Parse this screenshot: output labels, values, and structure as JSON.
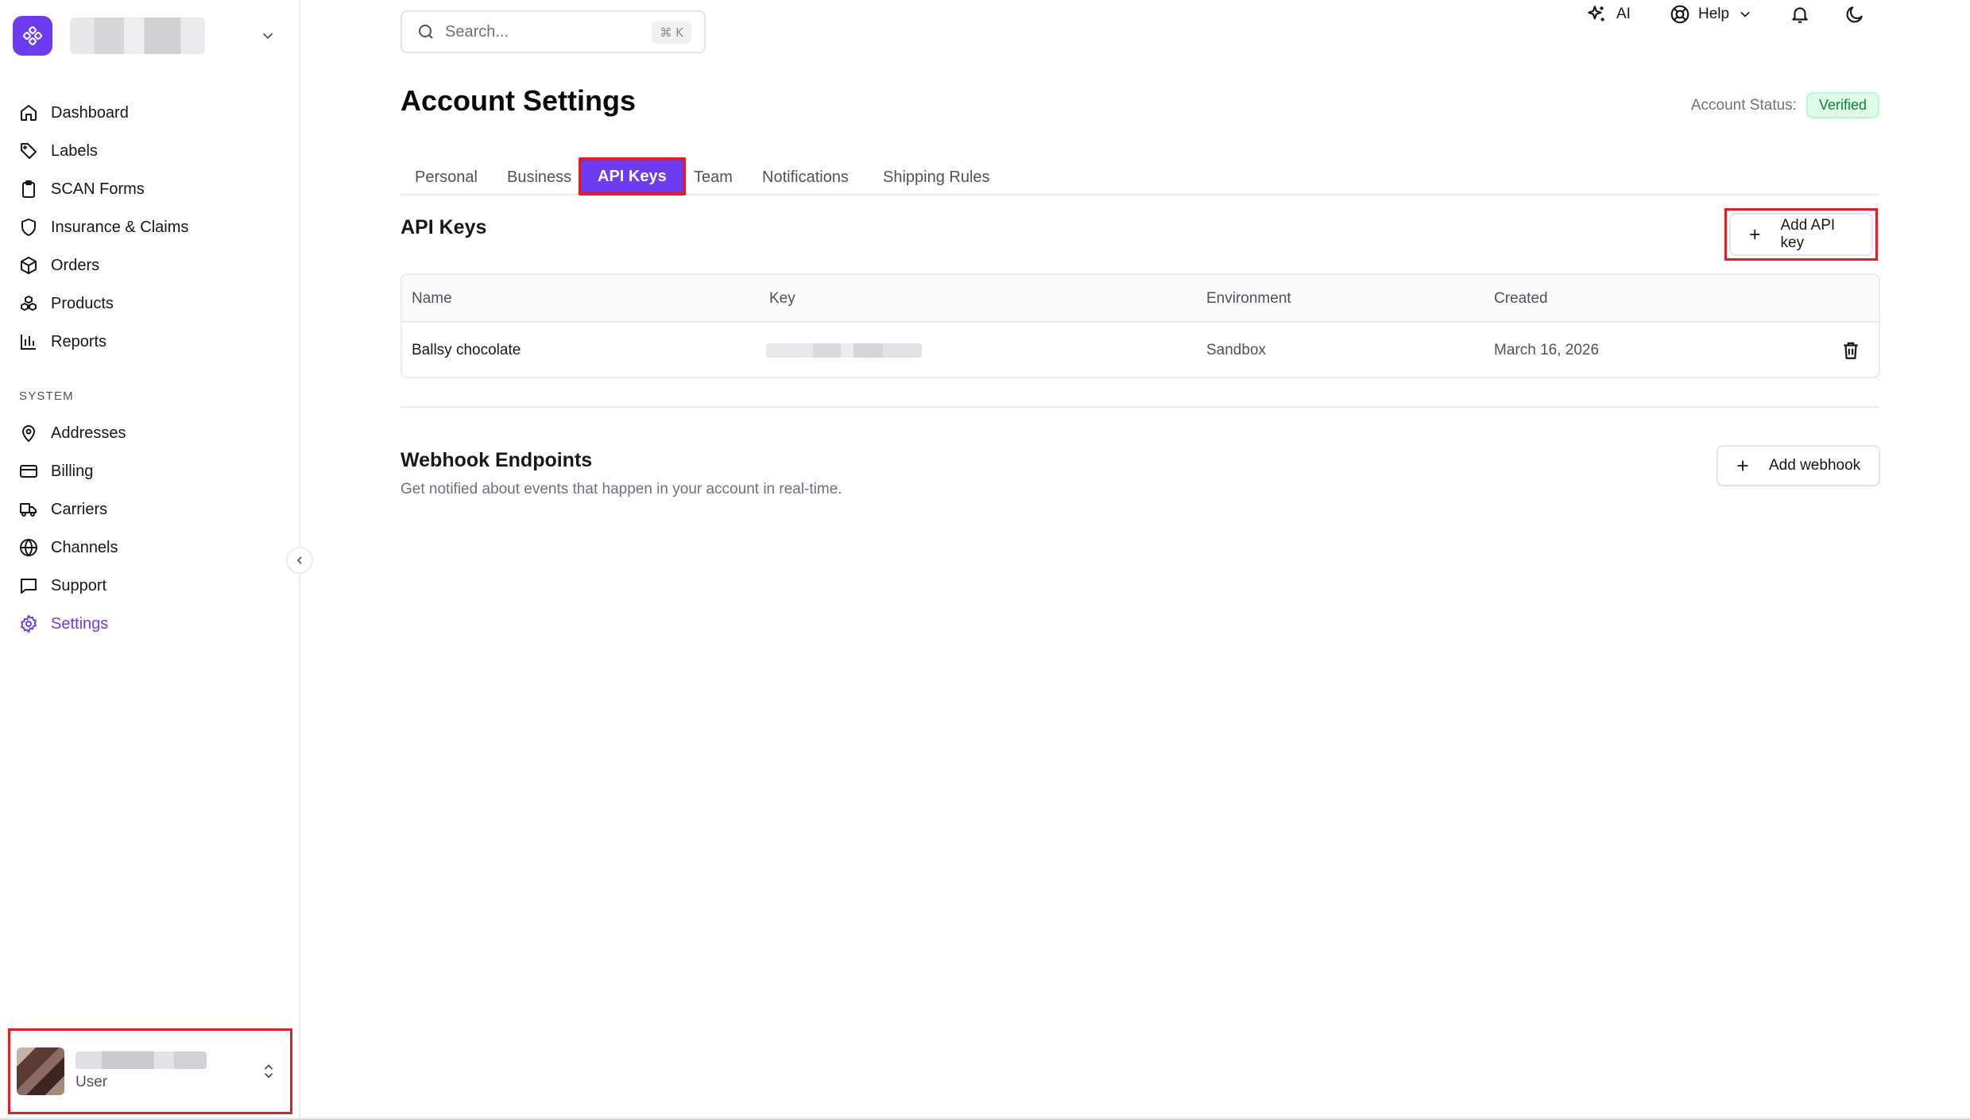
{
  "sidebar": {
    "nav": [
      {
        "label": "Dashboard",
        "icon": "home-icon"
      },
      {
        "label": "Labels",
        "icon": "tag-icon"
      },
      {
        "label": "SCAN Forms",
        "icon": "clipboard-icon"
      },
      {
        "label": "Insurance & Claims",
        "icon": "shield-icon"
      },
      {
        "label": "Orders",
        "icon": "package-icon"
      },
      {
        "label": "Products",
        "icon": "boxes-icon"
      },
      {
        "label": "Reports",
        "icon": "bar-chart-icon"
      }
    ],
    "system_label": "SYSTEM",
    "system": [
      {
        "label": "Addresses",
        "icon": "map-pin-icon"
      },
      {
        "label": "Billing",
        "icon": "credit-card-icon"
      },
      {
        "label": "Carriers",
        "icon": "truck-icon"
      },
      {
        "label": "Channels",
        "icon": "globe-icon"
      },
      {
        "label": "Support",
        "icon": "message-square-icon"
      },
      {
        "label": "Settings",
        "icon": "gear-icon",
        "active": true
      }
    ],
    "user": {
      "role": "User"
    }
  },
  "topbar": {
    "search_placeholder": "Search...",
    "search_shortcut": "⌘ K",
    "ai_label": "AI",
    "help_label": "Help"
  },
  "page": {
    "title": "Account Settings",
    "status_label": "Account Status:",
    "status_value": "Verified"
  },
  "tabs": [
    {
      "label": "Personal"
    },
    {
      "label": "Business"
    },
    {
      "label": "API Keys",
      "active": true
    },
    {
      "label": "Team"
    },
    {
      "label": "Notifications"
    },
    {
      "label": "Shipping Rules"
    }
  ],
  "api_keys": {
    "title": "API Keys",
    "add_label": "Add API key",
    "columns": [
      "Name",
      "Key",
      "Environment",
      "Created"
    ],
    "rows": [
      {
        "name": "Ballsy chocolate",
        "environment": "Sandbox",
        "created": "March 16, 2026"
      }
    ]
  },
  "webhooks": {
    "title": "Webhook Endpoints",
    "subtitle": "Get notified about events that happen in your account in real-time.",
    "add_label": "Add webhook"
  },
  "colors": {
    "accent": "#6d3cf0",
    "highlight": "#e11d2a",
    "verified_bg": "#dcfce7",
    "verified_text": "#15803d"
  }
}
